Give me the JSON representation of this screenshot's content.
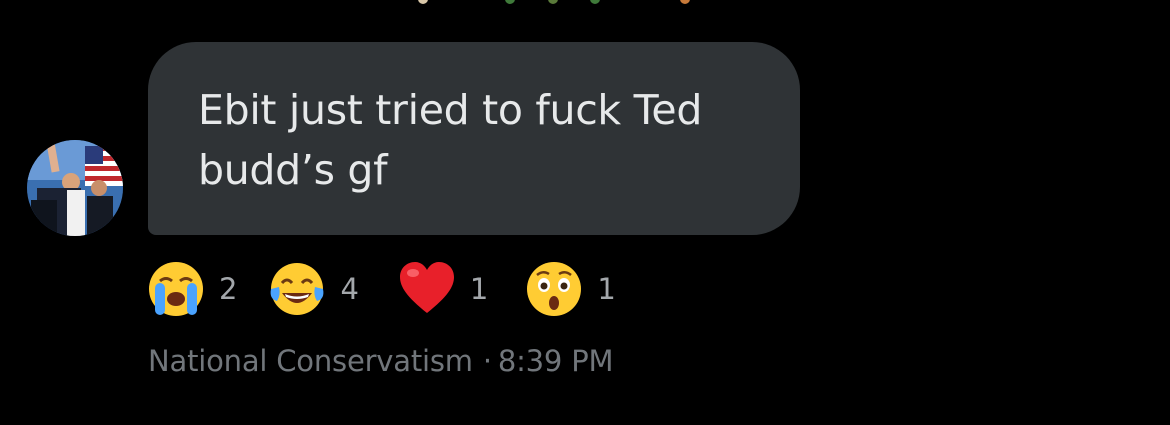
{
  "colors": {
    "background": "#000000",
    "bubble": "#2f3336",
    "message_text": "#e7e9ea",
    "reaction_count": "#a3a7ab",
    "meta_text": "#71767b"
  },
  "previous_message": {
    "partial_reaction_icons": [
      "emoji-icon",
      "emoji-icon",
      "emoji-icon",
      "emoji-icon",
      "emoji-icon"
    ]
  },
  "message": {
    "sender_avatar": "avatar-photo",
    "text": "Ebit just tried to fuck Ted budd’s gf",
    "reactions": [
      {
        "icon": "loudly-crying-face-icon",
        "count": "2"
      },
      {
        "icon": "face-with-tears-of-joy-icon",
        "count": "4"
      },
      {
        "icon": "red-heart-icon",
        "count": "1"
      },
      {
        "icon": "astonished-face-icon",
        "count": "1"
      }
    ],
    "sender_name": "National Conservatism",
    "separator": "·",
    "time": "8:39 PM"
  }
}
